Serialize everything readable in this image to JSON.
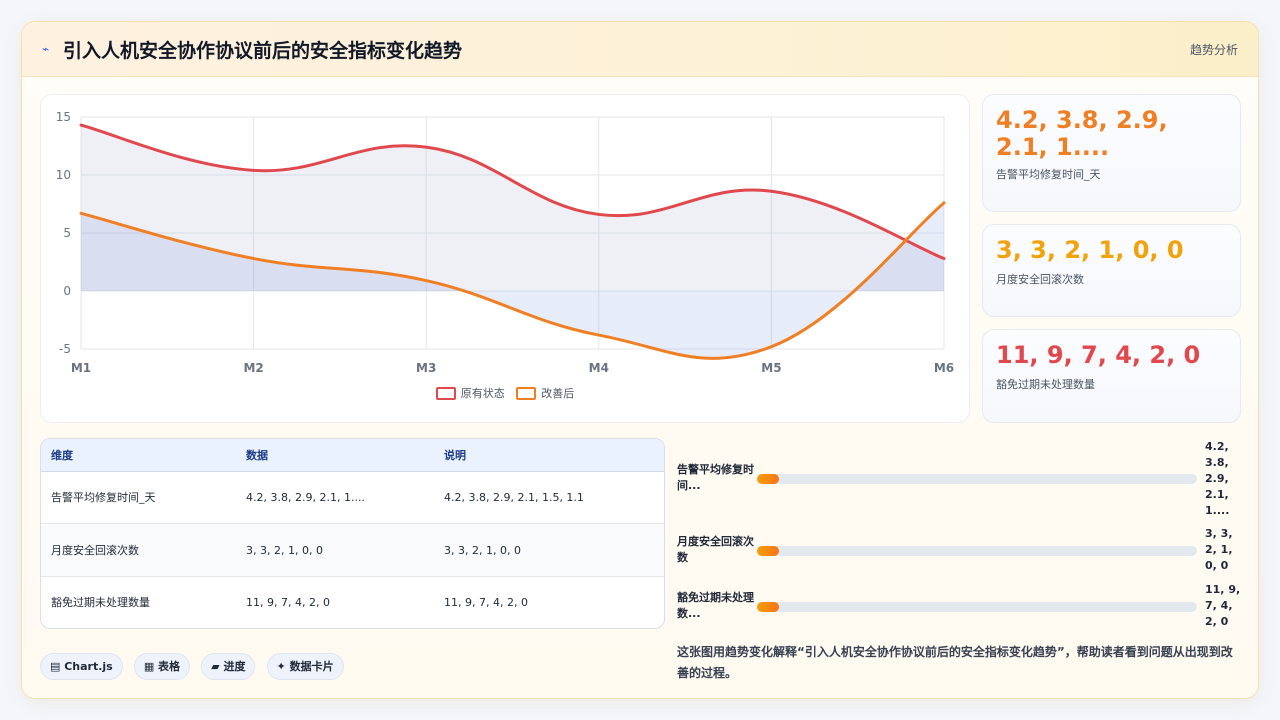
{
  "header": {
    "icon": "chart-icon",
    "title": "引入人机安全协作协议前后的安全指标变化趋势",
    "tag": "趋势分析"
  },
  "chart_data": {
    "type": "line",
    "categories": [
      "M1",
      "M2",
      "M3",
      "M4",
      "M5",
      "M6"
    ],
    "y_ticks": [
      "15",
      "10",
      "5",
      "0",
      "-5"
    ],
    "ylim": [
      -5,
      15
    ],
    "grid": true,
    "legend_position": "bottom",
    "series": [
      {
        "name": "原有状态",
        "values": [
          14.3,
          10.4,
          12.4,
          6.6,
          8.6,
          2.8
        ],
        "color": "#e0484e",
        "fill": "rgba(148,163,194,0.16)"
      },
      {
        "name": "改善后",
        "values": [
          6.7,
          2.8,
          0.9,
          -3.8,
          -4.8,
          7.6
        ],
        "color": "#f07f23",
        "fill": "rgba(120,150,220,0.18)"
      }
    ]
  },
  "stat_cards": [
    {
      "value": "4.2, 3.8, 2.9, 2.1, 1....",
      "label": "告警平均修复时间_天",
      "color": "#f07f23"
    },
    {
      "value": "3, 3, 2, 1, 0, 0",
      "label": "月度安全回滚次数",
      "color": "#f2a20d"
    },
    {
      "value": "11, 9, 7, 4, 2, 0",
      "label": "豁免过期未处理数量",
      "color": "#e0484e"
    }
  ],
  "table": {
    "headers": [
      "维度",
      "数据",
      "说明"
    ],
    "rows": [
      [
        "告警平均修复时间_天",
        "4.2, 3.8, 2.9, 2.1, 1....",
        "4.2, 3.8, 2.9, 2.1, 1.5, 1.1"
      ],
      [
        "月度安全回滚次数",
        "3, 3, 2, 1, 0, 0",
        "3, 3, 2, 1, 0, 0"
      ],
      [
        "豁免过期未处理数量",
        "11, 9, 7, 4, 2, 0",
        "11, 9, 7, 4, 2, 0"
      ]
    ]
  },
  "progress": [
    {
      "label": "告警平均修复时间...",
      "value": "4.2, 3.8, 2.9, 2.1, 1....",
      "fraction": 0.05
    },
    {
      "label": "月度安全回滚次数",
      "value": "3, 3, 2, 1, 0, 0",
      "fraction": 0.05
    },
    {
      "label": "豁免过期未处理数...",
      "value": "11, 9, 7, 4, 2, 0",
      "fraction": 0.05
    }
  ],
  "chips": [
    "▤ Chart.js",
    "▦ 表格",
    "▰ 进度",
    "✦ 数据卡片"
  ],
  "note": "这张图用趋势变化解释“引入人机安全协作协议前后的安全指标变化趋势”，帮助读者看到问题从出现到改善的过程。"
}
